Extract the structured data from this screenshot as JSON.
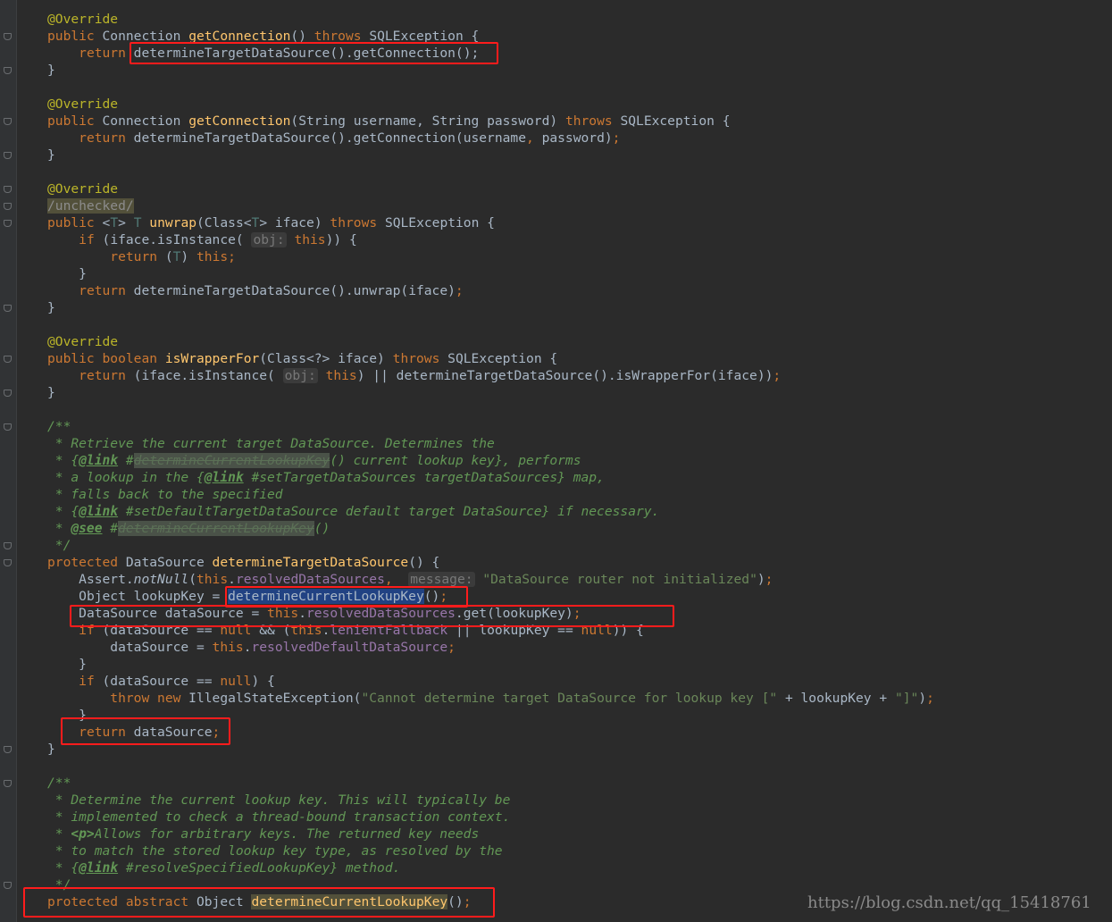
{
  "watermark": "https://blog.csdn.net/qq_15418761",
  "code": {
    "annotation": "@Override",
    "unchecked_suppression": "/unchecked/",
    "m1": {
      "public": "public",
      "type": "Connection",
      "name": "getConnection",
      "params": "()",
      "throws": "throws",
      "exception": "SQLException",
      "brace": "{",
      "ret": "return",
      "call": "determineTargetDataSource().getConnection();",
      "close": "}"
    },
    "m2": {
      "public": "public",
      "type": "Connection",
      "name": "getConnection",
      "params": "(String username, String password)",
      "throws": "throws",
      "exception": "SQLException",
      "brace": "{",
      "ret": "return",
      "call": "determineTargetDataSource().getConnection(username",
      "call_end": " password)",
      "close": "}"
    },
    "m3": {
      "public": "public",
      "gen_open": "<",
      "gen_t": "T",
      "gen_close": ">",
      "ret_type": "T",
      "name": "unwrap",
      "params_a": "(Class<",
      "params_t": "T",
      "params_b": "> iface)",
      "throws": "throws",
      "exception": "SQLException",
      "brace": "{",
      "if_kw": "if",
      "if_call": "(iface.isInstance(",
      "hint": "obj:",
      "this": "this",
      "if_end": ")) {",
      "inner_ret": "return",
      "cast_open": "(",
      "cast_t": "T",
      "cast_close": ")",
      "inner_this": "this",
      "close_if": "}",
      "ret": "return",
      "call": "determineTargetDataSource().unwrap(iface)",
      "close": "}"
    },
    "m4": {
      "public": "public",
      "type": "boolean",
      "name": "isWrapperFor",
      "params": "(Class<?> iface)",
      "throws": "throws",
      "exception": "SQLException",
      "brace": "{",
      "ret": "return",
      "call_a": "(iface.isInstance(",
      "hint": "obj:",
      "this": "this",
      "call_b": ") || determineTargetDataSource().isWrapperFor(iface))",
      "close": "}"
    },
    "doc1": {
      "open": "/**",
      "l1": " * Retrieve the current target DataSource. Determines the",
      "l2_a": " * {",
      "l2_link": "@link",
      "l2_hash": " #",
      "l2_dead": "determineCurrentLookupKey",
      "l2_b": "() current lookup key}, performs",
      "l3_a": " * a lookup in the {",
      "l3_link": "@link",
      "l3_b": " #setTargetDataSources targetDataSources} map,",
      "l4": " * falls back to the specified",
      "l5_a": " * {",
      "l5_link": "@link",
      "l5_b": " #setDefaultTargetDataSource default target DataSource} if necessary.",
      "l6_a": " * ",
      "l6_see": "@see",
      "l6_hash": " #",
      "l6_dead": "determineCurrentLookupKey",
      "l6_b": "()",
      "close": " */"
    },
    "m5": {
      "protected": "protected",
      "type": "DataSource",
      "name": "determineTargetDataSource",
      "params": "() {",
      "assert_a": "Assert.",
      "assert_fn": "notNull",
      "assert_open": "(",
      "assert_this": "this",
      "assert_dot": ".",
      "assert_fld": "resolvedDataSources",
      "assert_comma": ",",
      "assert_hint": "message:",
      "assert_str": "\"DataSource router not initialized\"",
      "assert_end": ")",
      "lk_type": "Object lookupKey = ",
      "lk_call": "determineCurrentLookupKey",
      "lk_end": "()",
      "ds_type": "DataSource dataSource = ",
      "ds_this": "this",
      "ds_dot": ".",
      "ds_fld": "resolvedDataSources",
      "ds_end": ".get(lookupKey)",
      "if1_kw": "if",
      "if1_a": " (dataSource == ",
      "if1_null": "null",
      "if1_b": " && (",
      "if1_this": "this",
      "if1_dot": ".",
      "if1_fld": "lenientFallback",
      "if1_c": " || lookupKey == ",
      "if1_null2": "null",
      "if1_d": ")) {",
      "assign_a": "dataSource = ",
      "assign_this": "this",
      "assign_dot": ".",
      "assign_fld": "resolvedDefaultDataSource",
      "close_if1": "}",
      "if2_kw": "if",
      "if2_a": " (dataSource == ",
      "if2_null": "null",
      "if2_b": ") {",
      "throw_kw": "throw",
      "new_kw": "new",
      "throw_type": " IllegalStateException(",
      "throw_str": "\"Cannot determine target DataSource for lookup key [\"",
      "throw_mid": " + lookupKey + ",
      "throw_str2": "\"]\"",
      "throw_end": ")",
      "close_if2": "}",
      "ret": "return",
      "ret_val": " dataSource",
      "close": "}"
    },
    "doc2": {
      "open": "/**",
      "l1": " * Determine the current lookup key. This will typically be",
      "l2": " * implemented to check a thread-bound transaction context.",
      "l3_a": " * ",
      "l3_p": "<p>",
      "l3_b": "Allows for arbitrary keys. The returned key needs",
      "l4": " * to match the stored lookup key type, as resolved by the",
      "l5_a": " * {",
      "l5_link": "@link",
      "l5_b": " #resolveSpecifiedLookupKey} method.",
      "close": " */"
    },
    "m6": {
      "protected": "protected",
      "abstract": "abstract",
      "type": "Object",
      "name": "determineCurrentLookupKey",
      "end": "()"
    },
    "semi": ";",
    "comma": ","
  }
}
